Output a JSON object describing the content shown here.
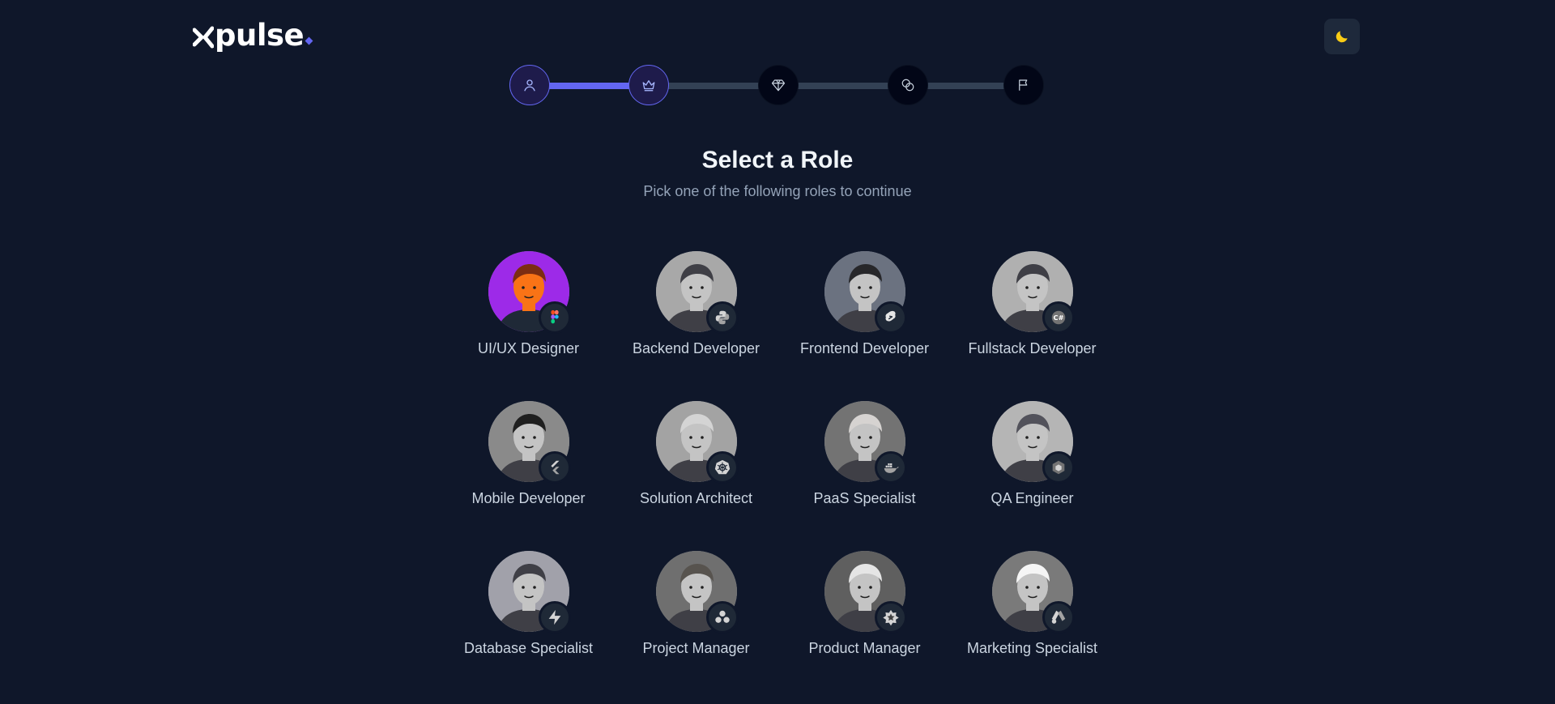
{
  "brand": {
    "name": "pulse"
  },
  "stepper": {
    "steps": [
      {
        "icon": "user-icon",
        "state": "done"
      },
      {
        "icon": "crown-icon",
        "state": "current"
      },
      {
        "icon": "diamond-icon",
        "state": "upcoming"
      },
      {
        "icon": "coins-icon",
        "state": "upcoming"
      },
      {
        "icon": "flag-icon",
        "state": "upcoming"
      }
    ]
  },
  "header": {
    "title": "Select a Role",
    "subtitle": "Pick one of the following roles to continue"
  },
  "theme": {
    "icon": "moon-icon",
    "accent": "#facc15"
  },
  "colors": {
    "background": "#0f172a",
    "accent": "#6366f1",
    "selected_avatar": "#9d2ae8"
  },
  "roles": [
    {
      "label": "UI/UX Designer",
      "badge_icon": "figma-icon",
      "selected": true
    },
    {
      "label": "Backend Developer",
      "badge_icon": "python-icon",
      "selected": false
    },
    {
      "label": "Frontend Developer",
      "badge_icon": "svelte-icon",
      "selected": false
    },
    {
      "label": "Fullstack Developer",
      "badge_icon": "csharp-icon",
      "selected": false
    },
    {
      "label": "Mobile Developer",
      "badge_icon": "flutter-icon",
      "selected": false
    },
    {
      "label": "Solution Architect",
      "badge_icon": "kubernetes-icon",
      "selected": false
    },
    {
      "label": "PaaS Specialist",
      "badge_icon": "docker-icon",
      "selected": false
    },
    {
      "label": "QA Engineer",
      "badge_icon": "hexagon-icon",
      "selected": false
    },
    {
      "label": "Database Specialist",
      "badge_icon": "supabase-icon",
      "selected": false
    },
    {
      "label": "Project Manager",
      "badge_icon": "asana-icon",
      "selected": false
    },
    {
      "label": "Product Manager",
      "badge_icon": "star-badge-icon",
      "selected": false
    },
    {
      "label": "Marketing Specialist",
      "badge_icon": "google-ads-icon",
      "selected": false
    }
  ]
}
